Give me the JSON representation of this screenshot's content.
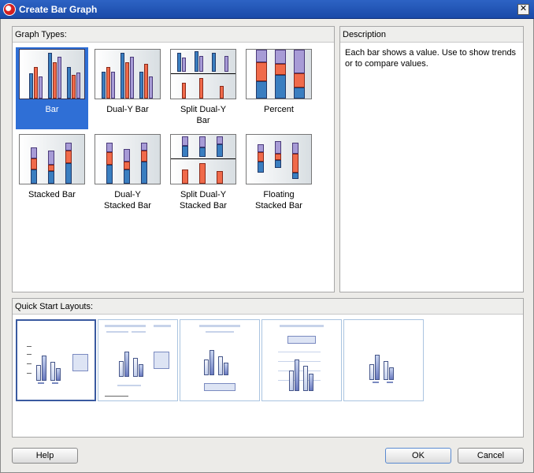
{
  "window": {
    "title": "Create Bar Graph",
    "close_glyph": "✕"
  },
  "graph_types": {
    "header": "Graph Types:",
    "items": [
      {
        "label": "Bar",
        "selected": true
      },
      {
        "label": "Dual-Y Bar"
      },
      {
        "label": "Split Dual-Y\nBar"
      },
      {
        "label": "Percent"
      },
      {
        "label": "Stacked Bar"
      },
      {
        "label": "Dual-Y\nStacked Bar"
      },
      {
        "label": "Split Dual-Y\nStacked Bar"
      },
      {
        "label": "Floating\nStacked Bar"
      }
    ]
  },
  "description": {
    "header": "Description",
    "text": "Each bar shows a value. Use to show trends or to compare values."
  },
  "quick_start": {
    "header": "Quick Start Layouts:",
    "layouts": [
      "layout-1",
      "layout-2",
      "layout-3",
      "layout-4",
      "layout-5"
    ],
    "selected_index": 0
  },
  "buttons": {
    "help": "Help",
    "ok": "OK",
    "cancel": "Cancel"
  },
  "colors": {
    "title_bar": "#2d63c4",
    "selection": "#2f6fd6",
    "bar_blue": "#3a7ec0",
    "bar_red": "#f06a4a",
    "bar_purple": "#a79bd6"
  }
}
